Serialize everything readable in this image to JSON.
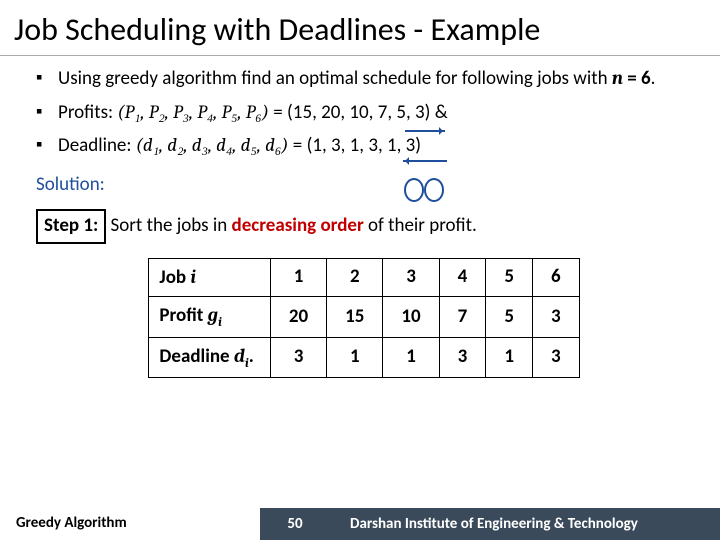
{
  "title": "Job Scheduling with Deadlines - Example",
  "bullets": {
    "b1_pre": "Using greedy algorithm find an optimal schedule for following jobs with ",
    "b1_nvar": "n",
    "b1_eq": " = ",
    "b1_nval": "6",
    "b1_post": ".",
    "b2_label": "Profits: ",
    "b2_lhs": "(P₁, P₂, P₃, P₄, P₅, P₆)",
    "b2_eq": "  =  ",
    "b2_rhs": "(15, 20, 10, 7, 5, 3)",
    "b2_amp": "  &",
    "b3_label": "Deadline: ",
    "b3_lhs": "(d₁, d₂, d₃, d₄, d₅, d₆)",
    "b3_eq": "  =  ",
    "b3_rhs": "(1, 3, 1, 3, 1, 3)"
  },
  "solution_label": "Solution:",
  "step1": {
    "box": "Step 1:",
    "pre": " Sort the jobs in ",
    "emph": "decreasing order",
    "post": " of their profit."
  },
  "chart_data": {
    "type": "table",
    "row_labels": [
      "Job i",
      "Profit gᵢ",
      "Deadline dᵢ."
    ],
    "columns": [
      "1",
      "2",
      "3",
      "4",
      "5",
      "6"
    ],
    "rows": {
      "job": [
        "1",
        "2",
        "3",
        "4",
        "5",
        "6"
      ],
      "profit": [
        "20",
        "15",
        "10",
        "7",
        "5",
        "3"
      ],
      "deadline": [
        "3",
        "1",
        "1",
        "3",
        "1",
        "3"
      ]
    }
  },
  "footer": {
    "left": "Greedy Algorithm",
    "page": "50",
    "right": "Darshan Institute of Engineering & Technology"
  }
}
